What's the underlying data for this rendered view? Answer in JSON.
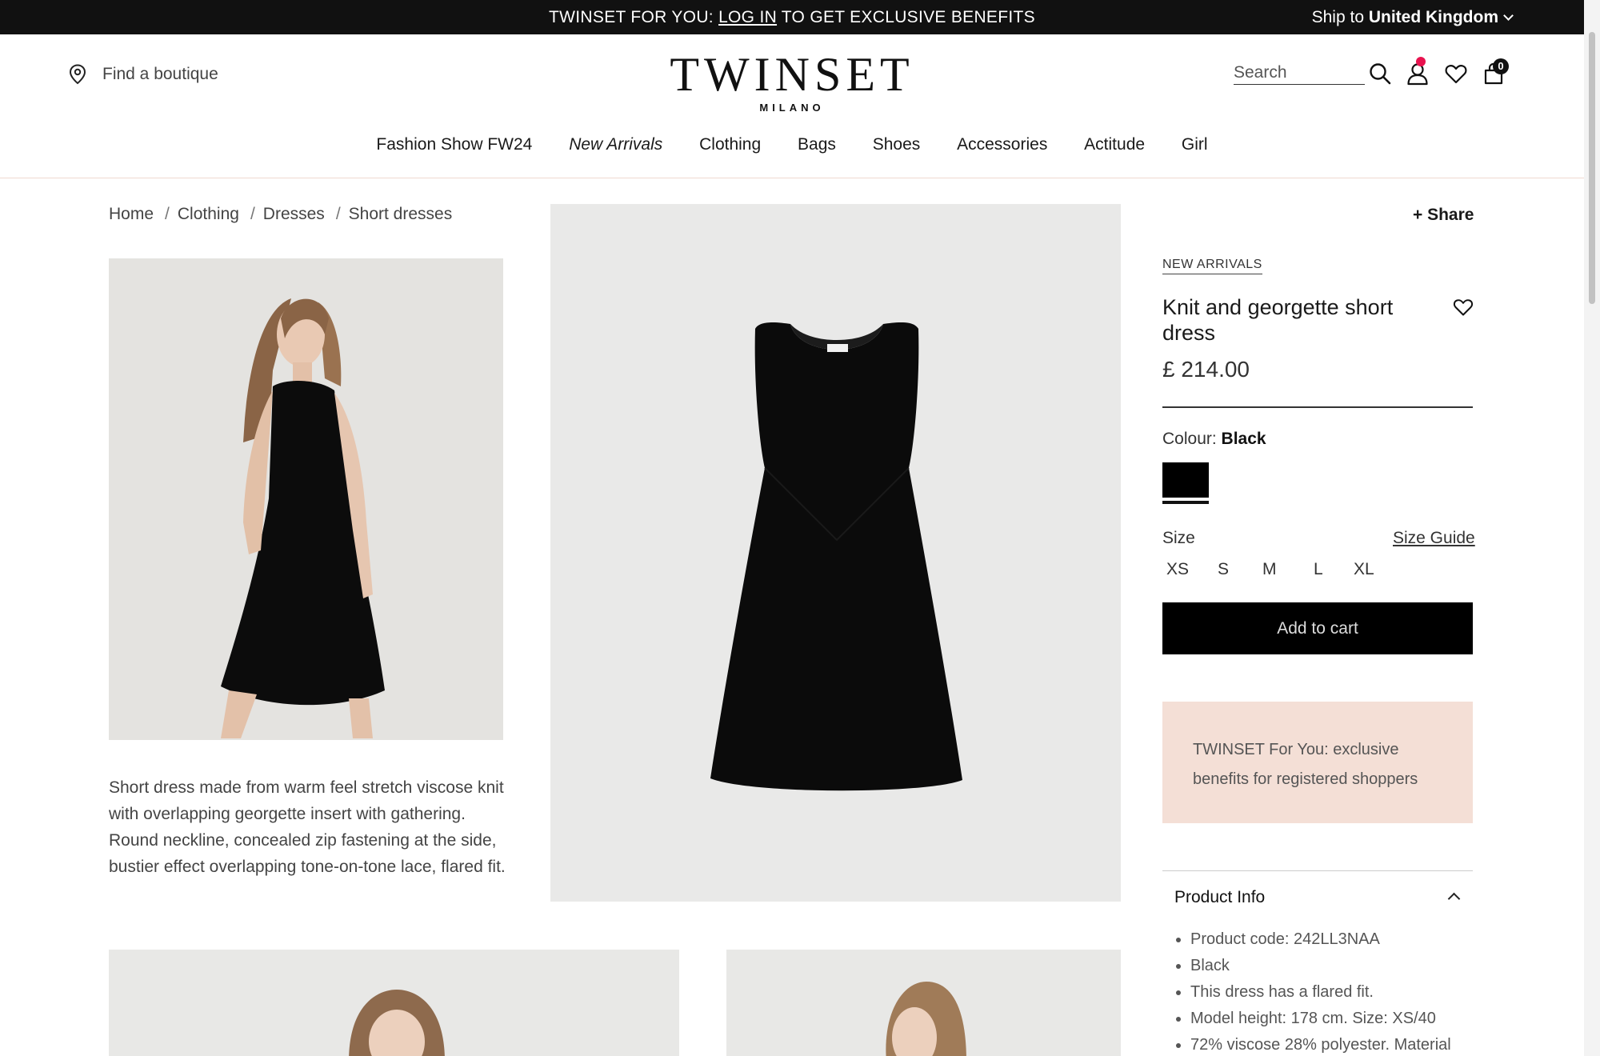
{
  "topbar": {
    "promo_prefix": "TWINSET FOR YOU: ",
    "promo_link": "LOG IN",
    "promo_suffix": " TO GET EXCLUSIVE BENEFITS",
    "ship_label": "Ship to ",
    "ship_country": "United Kingdom"
  },
  "header": {
    "find_boutique": "Find a boutique",
    "brand": "TWINSET",
    "brand_sub": "MILANO",
    "search_placeholder": "Search",
    "cart_count": "0",
    "icons": [
      "location-pin-icon",
      "search-icon",
      "user-icon",
      "heart-icon",
      "bag-icon"
    ]
  },
  "nav": {
    "items": [
      "Fashion Show FW24",
      "New Arrivals",
      "Clothing",
      "Bags",
      "Shoes",
      "Accessories",
      "Actitude",
      "Girl"
    ]
  },
  "breadcrumb": [
    "Home",
    "Clothing",
    "Dresses",
    "Short dresses"
  ],
  "description": "Short dress made from warm feel stretch viscose knit with overlapping georgette insert with gathering. Round neckline, concealed zip fastening at the side, bustier effect overlapping tone-on-tone lace, flared fit.",
  "product": {
    "share": "+ Share",
    "tag": "NEW ARRIVALS",
    "title": "Knit and georgette short dress",
    "price": "£ 214.00",
    "colour_label": "Colour: ",
    "colour_value": "Black",
    "size_label": "Size",
    "size_guide": "Size Guide",
    "sizes": [
      "XS",
      "S",
      "M",
      "L",
      "XL"
    ],
    "add_to_cart": "Add to cart",
    "promo": "TWINSET For You: exclusive benefits for registered shoppers",
    "info_heading": "Product Info",
    "info_items": [
      "Product code: 242LL3NAA",
      "Black",
      "This dress has a flared fit.",
      "Model height: 178 cm. Size: XS/40",
      "72% viscose 28% polyester. Material"
    ]
  },
  "colors": {
    "topbar_bg": "#111111",
    "button_bg": "#000000",
    "promo_bg": "#f4dfd6",
    "badge_dot": "#e8134f"
  }
}
